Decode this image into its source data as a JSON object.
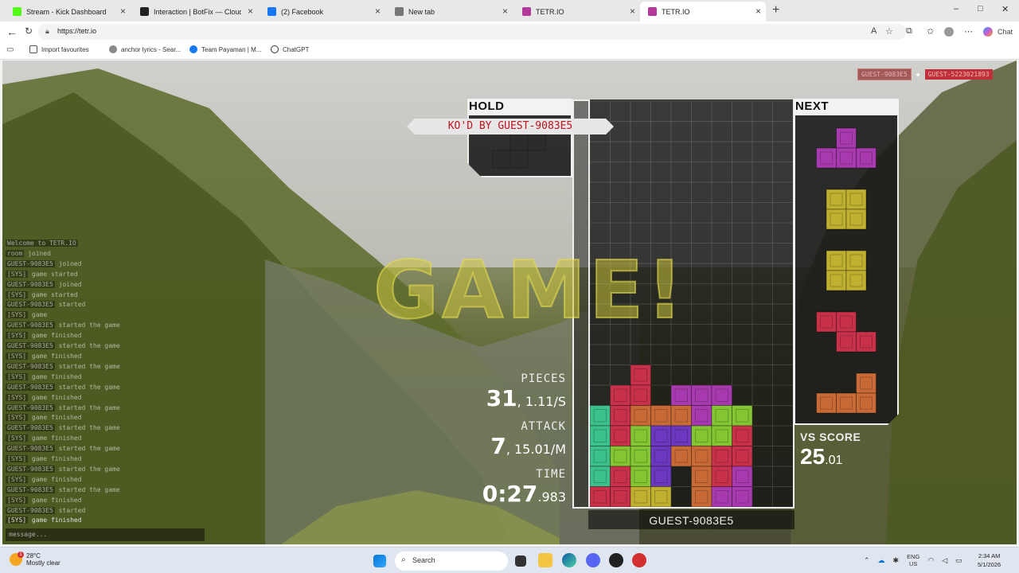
{
  "browser": {
    "tabs": [
      {
        "title": "Stream - Kick Dashboard",
        "color": "#53fc18",
        "active": false
      },
      {
        "title": "Interaction | BotFix — Cloud Stream",
        "color": "#222222",
        "active": false
      },
      {
        "title": "(2) Facebook",
        "color": "#1877f2",
        "active": false
      },
      {
        "title": "New tab",
        "color": "#777777",
        "active": false
      },
      {
        "title": "TETR.IO",
        "color": "#b2399a",
        "active": false
      },
      {
        "title": "TETR.IO",
        "color": "#b2399a",
        "active": true
      }
    ],
    "url": "https://tetr.io",
    "favorites": [
      {
        "label": "Import favourites"
      },
      {
        "label": "anchor lyrics - Sear..."
      },
      {
        "label": "Team Payaman | M..."
      },
      {
        "label": "ChatGPT"
      }
    ],
    "copilot_label": "Chat"
  },
  "game": {
    "chat": [
      {
        "who": "Welcome to TETR.IO",
        "msg": ""
      },
      {
        "who": "room",
        "msg": "joined"
      },
      {
        "who": "GUEST-9083E5",
        "msg": "joined"
      },
      {
        "who": "[SYS]",
        "msg": "game started"
      },
      {
        "who": "GUEST-9083E5",
        "msg": "joined"
      },
      {
        "who": "[SYS]",
        "msg": "game started"
      },
      {
        "who": "GUEST-9083E5",
        "msg": "started"
      },
      {
        "who": "[SYS]",
        "msg": "game"
      },
      {
        "who": "GUEST-9083E5",
        "msg": "started the game"
      },
      {
        "who": "[SYS]",
        "msg": "game finished"
      },
      {
        "who": "GUEST-9083E5",
        "msg": "started the game"
      },
      {
        "who": "[SYS]",
        "msg": "game finished"
      },
      {
        "who": "GUEST-9083E5",
        "msg": "started the game"
      },
      {
        "who": "[SYS]",
        "msg": "game finished"
      },
      {
        "who": "GUEST-9083E5",
        "msg": "started the game"
      },
      {
        "who": "[SYS]",
        "msg": "game finished"
      },
      {
        "who": "GUEST-9083E5",
        "msg": "started the game"
      },
      {
        "who": "[SYS]",
        "msg": "game finished"
      },
      {
        "who": "GUEST-9083E5",
        "msg": "started the game"
      },
      {
        "who": "[SYS]",
        "msg": "game finished"
      },
      {
        "who": "GUEST-9083E5",
        "msg": "started the game"
      },
      {
        "who": "[SYS]",
        "msg": "game finished"
      },
      {
        "who": "GUEST-9083E5",
        "msg": "started the game"
      },
      {
        "who": "[SYS]",
        "msg": "game finished"
      },
      {
        "who": "GUEST-9083E5",
        "msg": "started the game"
      },
      {
        "who": "[SYS]",
        "msg": "game finished"
      },
      {
        "who": "GUEST-9083E5",
        "msg": "started"
      },
      {
        "who": "[SYS]",
        "msg": "game finished",
        "last": true
      }
    ],
    "message_placeholder": "message...",
    "players": {
      "left": "GUEST-9083E5",
      "right": "GUEST-5223021893"
    },
    "hold_label": "HOLD",
    "next_label": "NEXT",
    "ko_banner": "KO'D BY GUEST-9083E5",
    "game_text": "GAME!",
    "stats": {
      "pieces_label": "PIECES",
      "pieces_value": "31",
      "pieces_rate": "1.11/S",
      "attack_label": "ATTACK",
      "attack_value": "7",
      "attack_rate": "15.01/M",
      "time_label": "TIME",
      "time_value": "0:27",
      "time_ms": ".983"
    },
    "vs_label": "VS SCORE",
    "vs_value": "25",
    "vs_decimal": ".01",
    "player_name": "GUEST-9083E5",
    "board_colors": {
      "Z": "#c8314a",
      "S": "#83c532",
      "L": "#c86a36",
      "J": "#6c38c0",
      "T": "#a83ab0",
      "O": "#c0b030",
      "I": "#3cc08c"
    },
    "board_rows": [
      "..........",
      "..........",
      "..........",
      "..........",
      "..........",
      "..........",
      "..........",
      "..........",
      "..........",
      "..........",
      "..........",
      "..........",
      "..........",
      "..Z.......",
      ".ZZ.TTT...",
      "IZLLLTSS..",
      "IZSJJSSZ..",
      "ISSJLLZZ..",
      "IZSJ.LZT..",
      "ZZOO.LTT.."
    ],
    "next_queue": [
      {
        "piece": "T",
        "cells": [
          [
            1,
            0
          ],
          [
            0,
            1
          ],
          [
            1,
            1
          ],
          [
            2,
            1
          ]
        ]
      },
      {
        "piece": "O",
        "cells": [
          [
            0,
            0
          ],
          [
            1,
            0
          ],
          [
            0,
            1
          ],
          [
            1,
            1
          ]
        ]
      },
      {
        "piece": "O",
        "cells": [
          [
            0,
            0
          ],
          [
            1,
            0
          ],
          [
            0,
            1
          ],
          [
            1,
            1
          ]
        ]
      },
      {
        "piece": "Z",
        "cells": [
          [
            0,
            0
          ],
          [
            1,
            0
          ],
          [
            1,
            1
          ],
          [
            2,
            1
          ]
        ]
      },
      {
        "piece": "L",
        "cells": [
          [
            2,
            0
          ],
          [
            0,
            1
          ],
          [
            1,
            1
          ],
          [
            2,
            1
          ]
        ]
      }
    ]
  },
  "taskbar": {
    "weather_temp": "28°C",
    "weather_desc": "Mostly clear",
    "search_placeholder": "Search",
    "lang_top": "ENG",
    "lang_bottom": "US",
    "time": "2:34 AM",
    "date": "5/1/2026"
  }
}
